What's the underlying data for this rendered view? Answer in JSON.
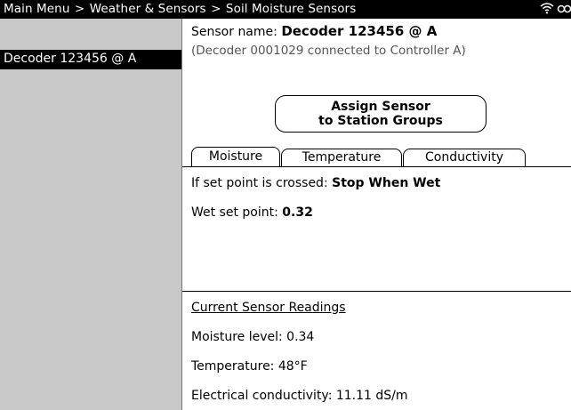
{
  "breadcrumb": {
    "items": [
      "Main Menu",
      "Weather & Sensors",
      "Soil Moisture Sensors"
    ],
    "separator": ">"
  },
  "status_icons": [
    "wifi-icon",
    "link-icon"
  ],
  "sidebar": {
    "items": [
      {
        "label": "Decoder 123456 @ A",
        "selected": true
      }
    ]
  },
  "sensor": {
    "name_label": "Sensor name:",
    "name_value": "Decoder 123456 @ A",
    "connection_info": "(Decoder 0001029 connected to Controller A)"
  },
  "assign_button": {
    "line1": "Assign Sensor",
    "line2": "to Station Groups"
  },
  "tabs": [
    {
      "label": "Moisture",
      "active": true
    },
    {
      "label": "Temperature",
      "active": false
    },
    {
      "label": "Conductivity",
      "active": false
    }
  ],
  "settings": {
    "crossed_label": "If set point is crossed:",
    "crossed_value": "Stop When Wet",
    "wet_label": "Wet set point:",
    "wet_value": "0.32"
  },
  "readings": {
    "heading": "Current Sensor Readings",
    "moisture": "Moisture level: 0.34",
    "temperature": "Temperature: 48°F",
    "conductivity": "Electrical conductivity: 11.11  dS/m"
  }
}
